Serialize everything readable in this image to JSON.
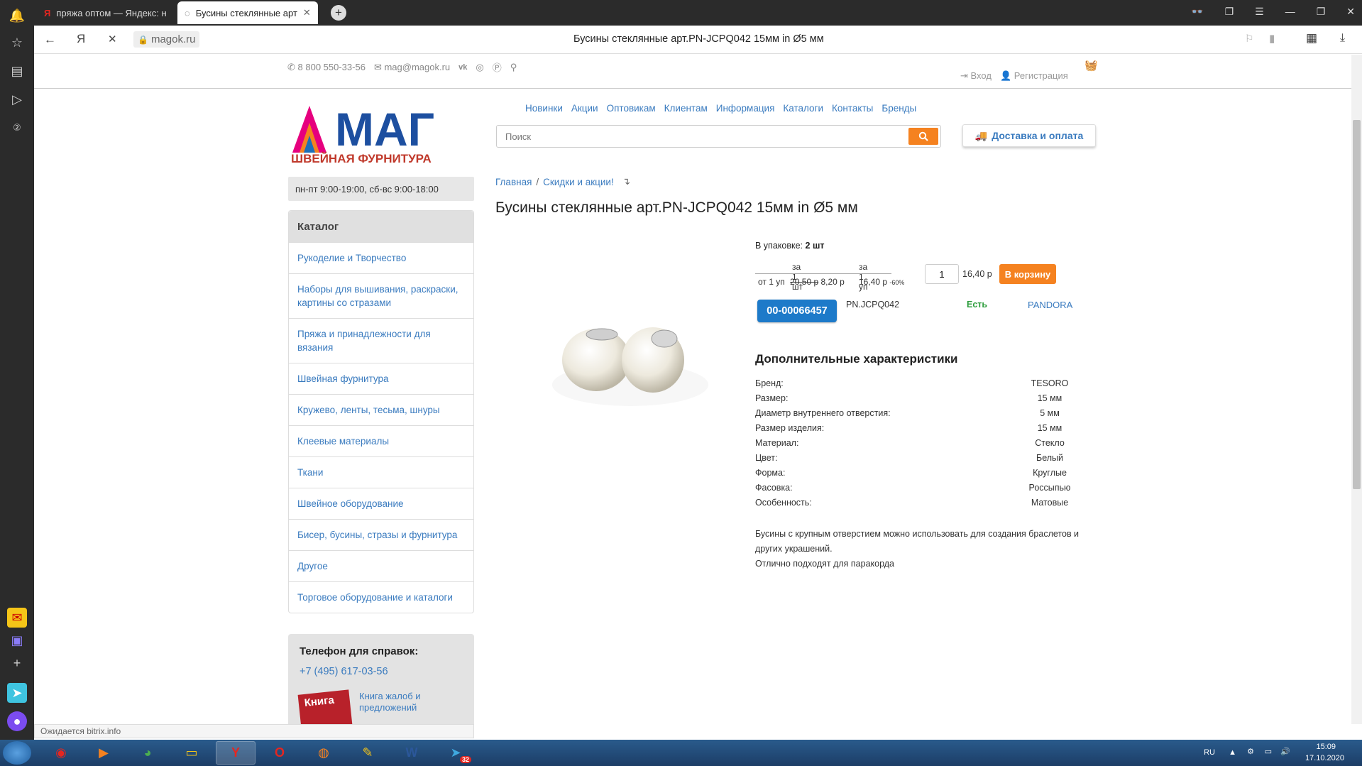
{
  "browser": {
    "tabs": [
      {
        "title": "пряжа оптом — Яндекс: н",
        "favicon": "yandex-icon"
      },
      {
        "title": "Бусины стеклянные арт",
        "favicon": "loading-icon"
      }
    ],
    "address": "magok.ru",
    "page_title": "Бусины стеклянные арт.PN-JCPQ042 15мм in Ø5 мм",
    "status_hint": "Ожидается bitrix.info"
  },
  "site": {
    "phone_top": "8 800 550-33-56",
    "email": "mag@magok.ru",
    "login": "Вход",
    "register": "Регистрация",
    "logo_main": "МАГ",
    "logo_sub": "ШВЕЙНАЯ ФУРНИТУРА",
    "schedule": "пн-пт 9:00-19:00, сб-вс 9:00-18:00",
    "nav": [
      "Новинки",
      "Акции",
      "Оптовикам",
      "Клиентам",
      "Информация",
      "Каталоги",
      "Контакты",
      "Бренды"
    ],
    "search_placeholder": "Поиск",
    "delivery": "Доставка и оплата"
  },
  "catalog": {
    "title": "Каталог",
    "items": [
      "Рукоделие и Творчество",
      "Наборы для вышивания, раскраски, картины со стразами",
      "Пряжа и принадлежности для вязания",
      "Швейная фурнитура",
      "Кружево, ленты, тесьма, шнуры",
      "Клеевые материалы",
      "Ткани",
      "Швейное оборудование",
      "Бисер, бусины, стразы и фурнитура",
      "Другое",
      "Торговое оборудование и каталоги"
    ]
  },
  "help": {
    "title": "Телефон для справок:",
    "phone": "+7 (495) 617-03-56",
    "book_label": "Книга",
    "book_link": "Книга жалоб и предложений"
  },
  "breadcrumb": [
    "Главная",
    "/",
    "Скидки и акции!"
  ],
  "product": {
    "title": "Бусины стеклянные арт.PN-JCPQ042 15мм in Ø5 мм",
    "pack_label": "В упаковке:",
    "pack_value": "2 шт",
    "price_head_1": "за 1 шт",
    "price_head_2": "за 1 уп",
    "price_row_from": "от 1 уп",
    "price_old": "20,50 р",
    "price_new": "8,20 р",
    "price_pack": "16,40 р",
    "price_discount": "-60%",
    "qty": "1",
    "total": "16,40 р",
    "to_cart": "В корзину",
    "code": "00-00066457",
    "article": "PN.JCPQ042",
    "stock": "Есть",
    "brand_link": "PANDORA"
  },
  "characteristics": {
    "title": "Дополнительные характеристики",
    "rows": [
      {
        "k": "Бренд:",
        "v": "TESORO"
      },
      {
        "k": "Размер:",
        "v": "15 мм"
      },
      {
        "k": "Диаметр внутреннего отверстия:",
        "v": "5 мм"
      },
      {
        "k": "Размер изделия:",
        "v": "15 мм"
      },
      {
        "k": "Материал:",
        "v": "Стекло"
      },
      {
        "k": "Цвет:",
        "v": "Белый"
      },
      {
        "k": "Форма:",
        "v": "Круглые"
      },
      {
        "k": "Фасовка:",
        "v": "Россыпью"
      },
      {
        "k": "Особенность:",
        "v": "Матовые"
      }
    ]
  },
  "description": [
    "Бусины с крупным отверстием можно использовать для создания браслетов и других украшений.",
    "Отлично подходят для паракорда"
  ],
  "taskbar": {
    "lang": "RU",
    "time": "15:09",
    "date": "17.10.2020",
    "telegram_badge": "32"
  },
  "colors": {
    "accent_orange": "#f58220",
    "link_blue": "#3a7bbf",
    "code_blue": "#1d7ac9",
    "stock_green": "#2e9e3e"
  }
}
